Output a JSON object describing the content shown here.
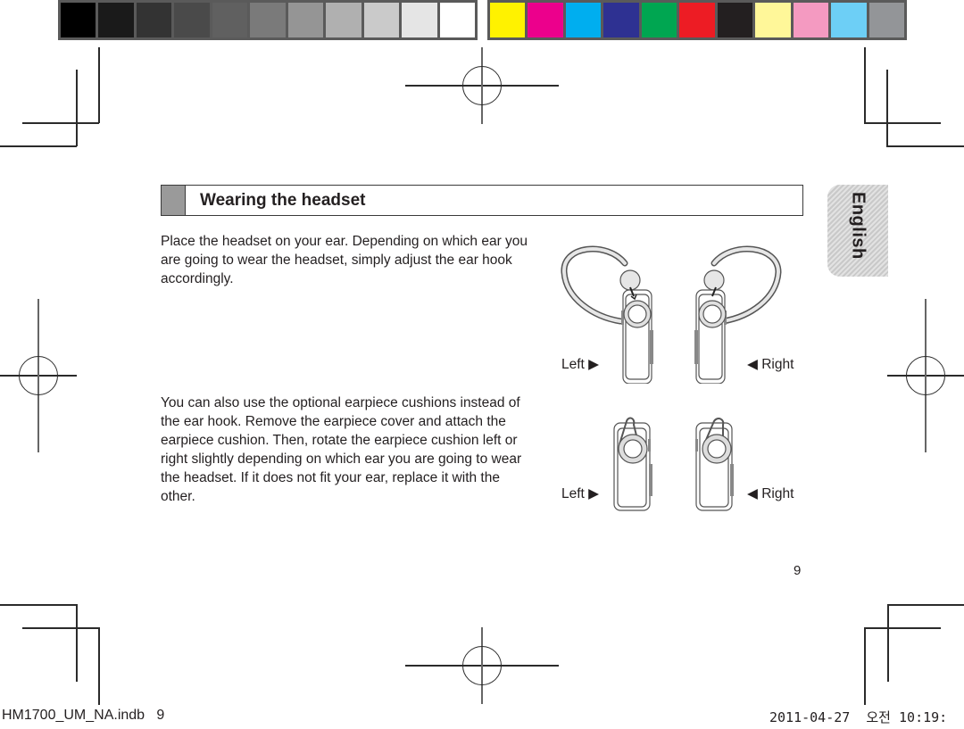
{
  "color_bars": {
    "grayscale": [
      "#000000",
      "#1a1a1a",
      "#333333",
      "#4a4a4a",
      "#606060",
      "#7a7a7a",
      "#959595",
      "#b0b0b0",
      "#cacaca",
      "#e5e5e5",
      "#ffffff"
    ],
    "process": [
      "#fff200",
      "#ec008c",
      "#00aeef",
      "#2e3192",
      "#00a651",
      "#ed1c24",
      "#231f20",
      "#fff799",
      "#f49ac1",
      "#6dcff6",
      "#939598"
    ]
  },
  "section": {
    "title": "Wearing the headset",
    "paragraph_1": "Place the headset on your ear. Depending on which ear you are going to wear the headset, simply adjust the ear hook accordingly.",
    "paragraph_2": "You can also use the optional earpiece cushions instead of the ear hook. Remove the earpiece cover and attach the earpiece cushion. Then, rotate the earpiece cushion left or right slightly depending on which ear you are going to wear the headset. If it does not fit your ear, replace it with the other."
  },
  "language_tab": "English",
  "figures": {
    "ear_hook": {
      "left_label": "Left ▶",
      "right_label": "◀ Right"
    },
    "cushion": {
      "left_label": "Left ▶",
      "right_label": "◀ Right"
    }
  },
  "page_number": "9",
  "slug": {
    "file": "HM1700_UM_NA.indb",
    "file_page": "9",
    "date": "2011-04-27",
    "ampm": "오전",
    "time": "10:19:"
  }
}
